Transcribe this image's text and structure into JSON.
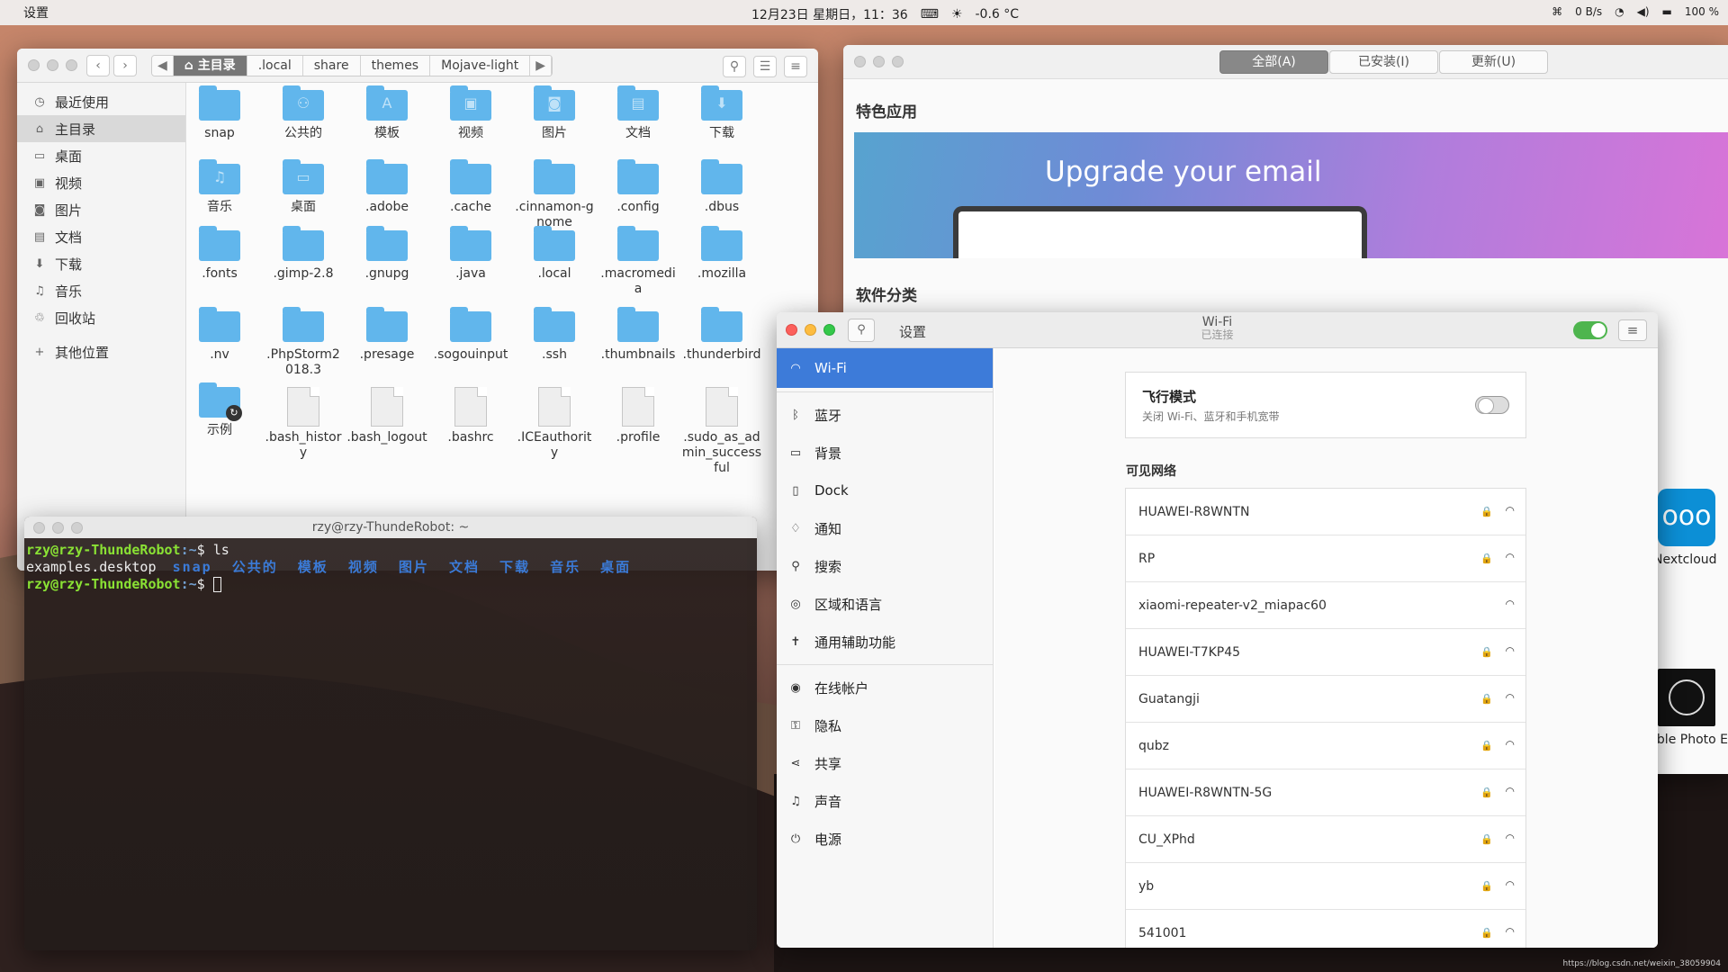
{
  "topbar": {
    "app_name": "设置",
    "datetime": "12月23日 星期日，11：36",
    "temperature": "-0.6 °C",
    "net_speed": "0 B/s",
    "battery": "100 %"
  },
  "files": {
    "breadcrumb": [
      "主目录",
      ".local",
      "share",
      "themes",
      "Mojave-light"
    ],
    "sidebar": [
      {
        "label": "最近使用",
        "icon": "clock-icon"
      },
      {
        "label": "主目录",
        "icon": "home-icon",
        "selected": true
      },
      {
        "label": "桌面",
        "icon": "desktop-icon"
      },
      {
        "label": "视频",
        "icon": "video-icon"
      },
      {
        "label": "图片",
        "icon": "camera-icon"
      },
      {
        "label": "文档",
        "icon": "document-icon"
      },
      {
        "label": "下载",
        "icon": "download-icon"
      },
      {
        "label": "音乐",
        "icon": "music-icon"
      },
      {
        "label": "回收站",
        "icon": "trash-icon"
      },
      {
        "label": "其他位置",
        "icon": "plus-icon"
      }
    ],
    "items": [
      {
        "name": "snap",
        "type": "folder"
      },
      {
        "name": "公共的",
        "type": "folder"
      },
      {
        "name": "模板",
        "type": "folder"
      },
      {
        "name": "视频",
        "type": "folder"
      },
      {
        "name": "图片",
        "type": "folder"
      },
      {
        "name": "文档",
        "type": "folder"
      },
      {
        "name": "下载",
        "type": "folder"
      },
      {
        "name": "音乐",
        "type": "folder"
      },
      {
        "name": "桌面",
        "type": "folder"
      },
      {
        "name": ".adobe",
        "type": "folder"
      },
      {
        "name": ".cache",
        "type": "folder"
      },
      {
        "name": ".cinnamon-gnome",
        "type": "folder"
      },
      {
        "name": ".config",
        "type": "folder"
      },
      {
        "name": ".dbus",
        "type": "folder"
      },
      {
        "name": ".fonts",
        "type": "folder"
      },
      {
        "name": ".gimp-2.8",
        "type": "folder"
      },
      {
        "name": ".gnupg",
        "type": "folder"
      },
      {
        "name": ".java",
        "type": "folder"
      },
      {
        "name": ".local",
        "type": "folder"
      },
      {
        "name": ".macromedia",
        "type": "folder"
      },
      {
        "name": ".mozilla",
        "type": "folder"
      },
      {
        "name": ".nv",
        "type": "folder"
      },
      {
        "name": ".PhpStorm2018.3",
        "type": "folder"
      },
      {
        "name": ".presage",
        "type": "folder"
      },
      {
        "name": ".sogouinput",
        "type": "folder"
      },
      {
        "name": ".ssh",
        "type": "folder"
      },
      {
        "name": ".thumbnails",
        "type": "folder"
      },
      {
        "name": ".thunderbird",
        "type": "folder"
      },
      {
        "name": "示例",
        "type": "link"
      },
      {
        "name": ".bash_history",
        "type": "file"
      },
      {
        "name": ".bash_logout",
        "type": "file"
      },
      {
        "name": ".bashrc",
        "type": "file"
      },
      {
        "name": ".ICEauthority",
        "type": "file"
      },
      {
        "name": ".profile",
        "type": "file"
      },
      {
        "name": ".sudo_as_admin_successful",
        "type": "file"
      }
    ]
  },
  "terminal": {
    "title": "rzy@rzy-ThundeRobot: ~",
    "prompt_user": "rzy@rzy-ThundeRobot",
    "prompt_path": ":~",
    "prompt_char": "$",
    "command": "ls",
    "output_file": "examples.desktop",
    "output_dirs": "snap  公共的  模板  视频  图片  文档  下载  音乐  桌面"
  },
  "software": {
    "tabs": [
      "全部(A)",
      "已安装(I)",
      "更新(U)"
    ],
    "featured_title": "特色应用",
    "banner_text": "Upgrade your email",
    "category_title": "软件分类",
    "apps": [
      "Nextcloud",
      "Darktable Photo E"
    ]
  },
  "settings": {
    "app_title": "设置",
    "page_title": "Wi-Fi",
    "page_subtitle": "已连接",
    "nav": [
      {
        "label": "Wi-Fi",
        "icon": "wifi-icon",
        "selected": true
      },
      {
        "label": "蓝牙",
        "icon": "bluetooth-icon"
      },
      {
        "label": "背景",
        "icon": "background-icon"
      },
      {
        "label": "Dock",
        "icon": "dock-icon"
      },
      {
        "label": "通知",
        "icon": "bell-icon"
      },
      {
        "label": "搜索",
        "icon": "search-icon"
      },
      {
        "label": "区域和语言",
        "icon": "globe-icon"
      },
      {
        "label": "通用辅助功能",
        "icon": "accessibility-icon"
      },
      {
        "label": "在线帐户",
        "icon": "cloud-account-icon"
      },
      {
        "label": "隐私",
        "icon": "lock-icon"
      },
      {
        "label": "共享",
        "icon": "share-icon"
      },
      {
        "label": "声音",
        "icon": "music-note-icon"
      },
      {
        "label": "电源",
        "icon": "power-icon"
      }
    ],
    "airplane_title": "飞行模式",
    "airplane_desc": "关闭 Wi-Fi、蓝牙和手机宽带",
    "visible_networks_label": "可见网络",
    "networks": [
      {
        "ssid": "HUAWEI-R8WNTN",
        "locked": true
      },
      {
        "ssid": "RP",
        "locked": true
      },
      {
        "ssid": "xiaomi-repeater-v2_miapac60",
        "locked": false
      },
      {
        "ssid": "HUAWEI-T7KP45",
        "locked": true
      },
      {
        "ssid": "Guatangji",
        "locked": true
      },
      {
        "ssid": "qubz",
        "locked": true
      },
      {
        "ssid": "HUAWEI-R8WNTN-5G",
        "locked": true
      },
      {
        "ssid": "CU_XPhd",
        "locked": true
      },
      {
        "ssid": "yb",
        "locked": true
      },
      {
        "ssid": "541001",
        "locked": true
      }
    ]
  },
  "credit": "https://blog.csdn.net/weixin_38059904"
}
